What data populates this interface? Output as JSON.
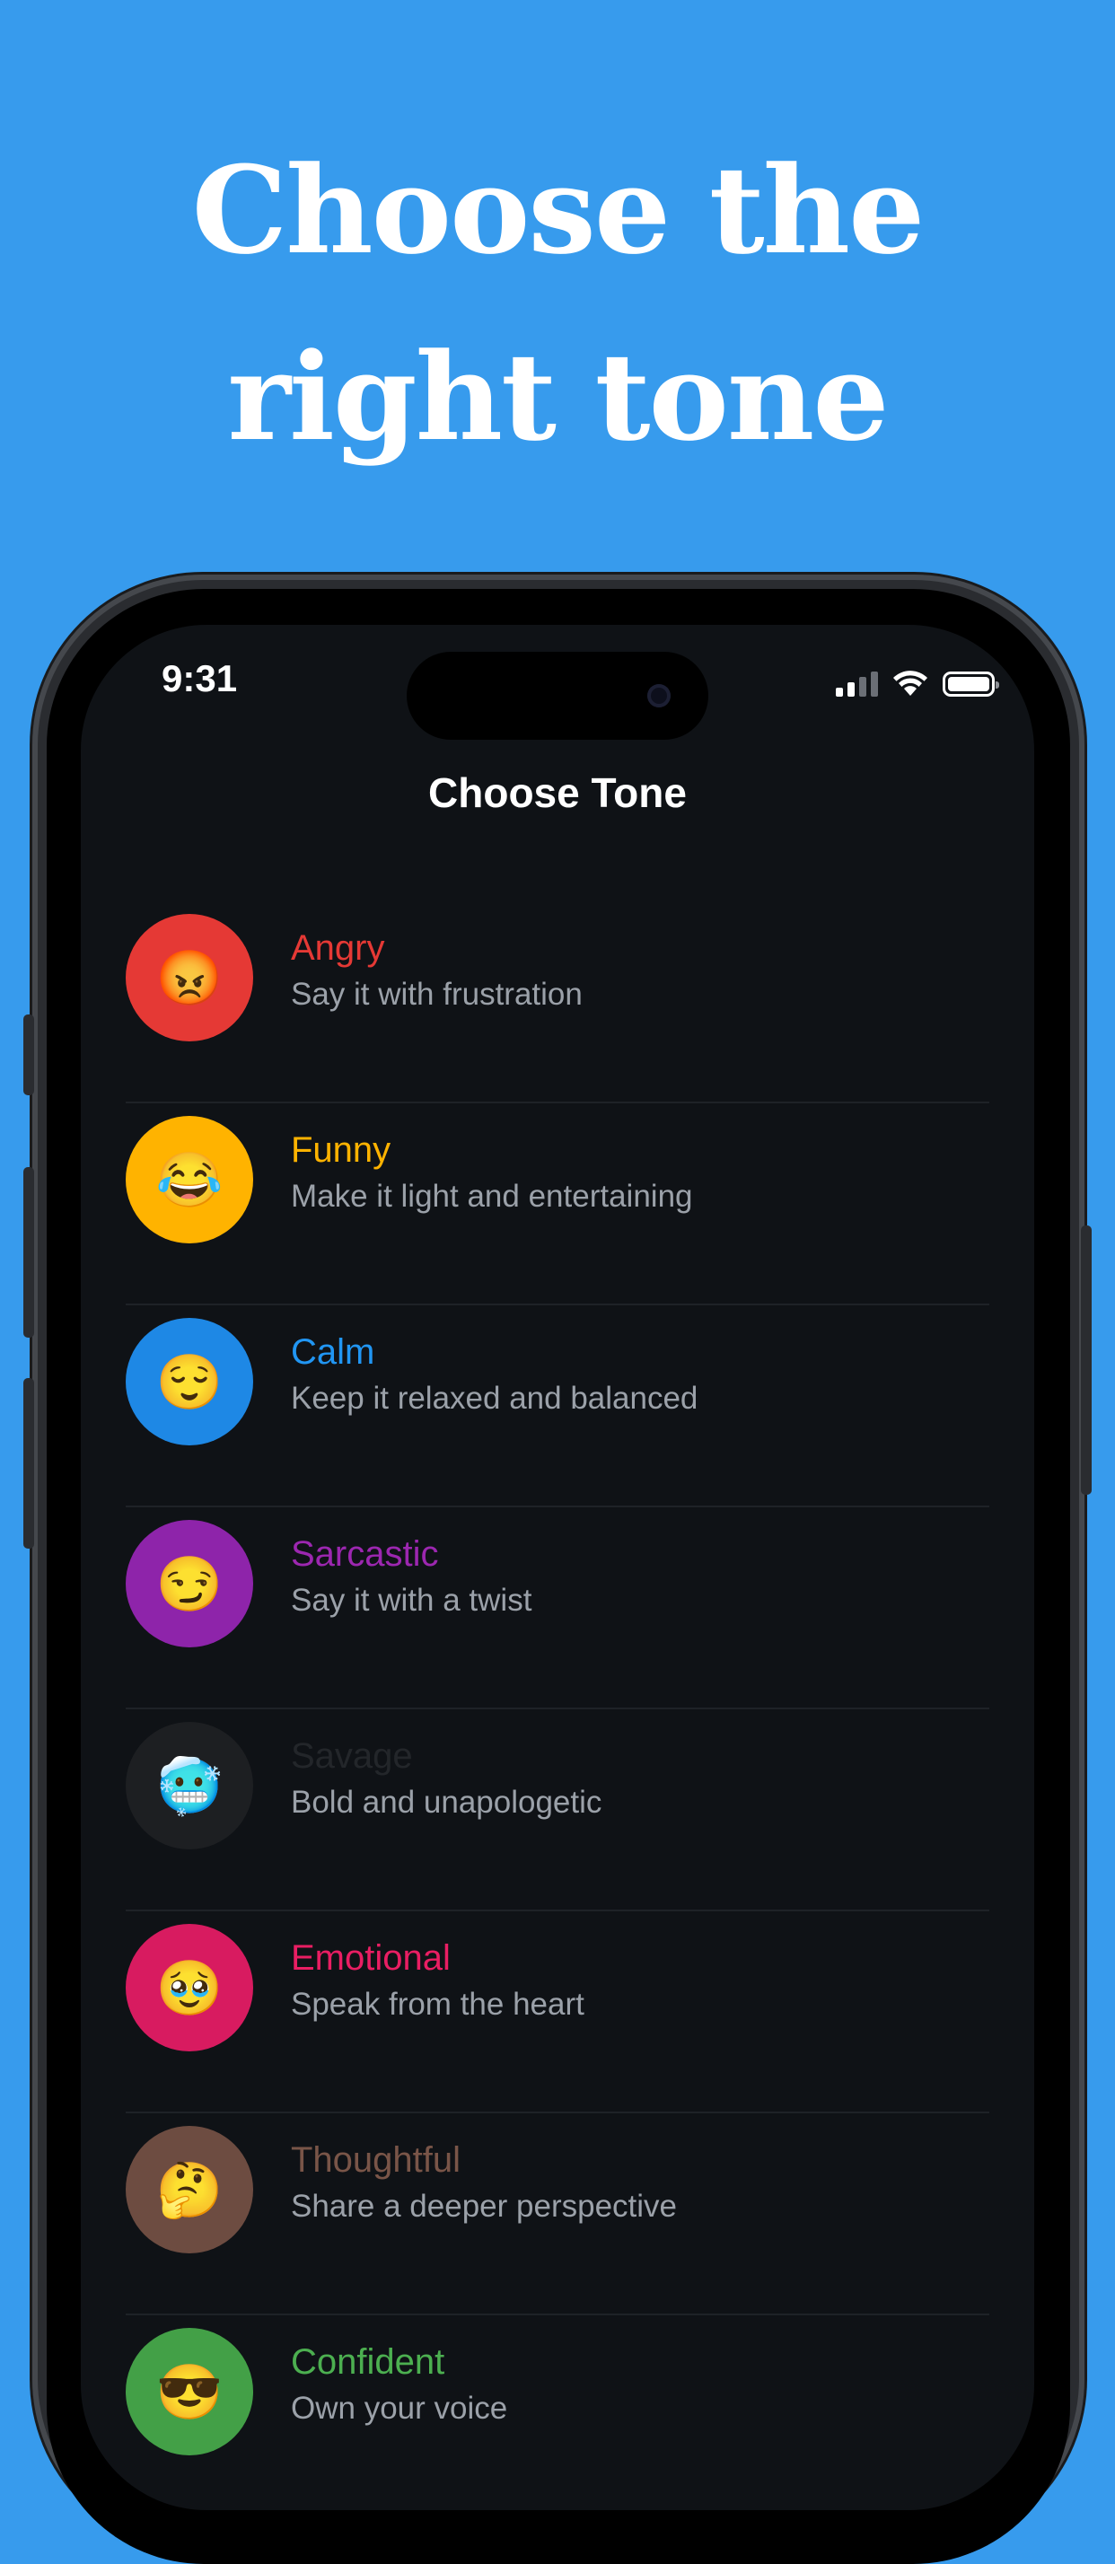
{
  "headline": {
    "line1": "Choose the",
    "line2": "right tone"
  },
  "status_bar": {
    "time": "9:31"
  },
  "screen": {
    "title": "Choose Tone"
  },
  "tones": [
    {
      "name": "Angry",
      "description": "Say it with frustration",
      "emoji": "😡",
      "color": "#e53935",
      "name_color": "#e53935"
    },
    {
      "name": "Funny",
      "description": "Make it light and entertaining",
      "emoji": "😂",
      "color": "#ffb300",
      "name_color": "#ffb300"
    },
    {
      "name": "Calm",
      "description": "Keep it relaxed and balanced",
      "emoji": "😌",
      "color": "#1e88e5",
      "name_color": "#2196f3"
    },
    {
      "name": "Sarcastic",
      "description": "Say it with a twist",
      "emoji": "😏",
      "color": "#8e24aa",
      "name_color": "#9c27b0"
    },
    {
      "name": "Savage",
      "description": "Bold and unapologetic",
      "emoji": "🥶",
      "color": "#1d1f22",
      "name_color": "#23262a"
    },
    {
      "name": "Emotional",
      "description": "Speak from the heart",
      "emoji": "🥹",
      "color": "#d81b60",
      "name_color": "#e91e63"
    },
    {
      "name": "Thoughtful",
      "description": "Share a deeper perspective",
      "emoji": "🤔",
      "color": "#6d4c41",
      "name_color": "#795548"
    },
    {
      "name": "Confident",
      "description": "Own your voice",
      "emoji": "😎",
      "color": "#43a047",
      "name_color": "#4caf50"
    }
  ],
  "colors": {
    "background": "#379bed",
    "screen_bg": "#0f1216"
  }
}
